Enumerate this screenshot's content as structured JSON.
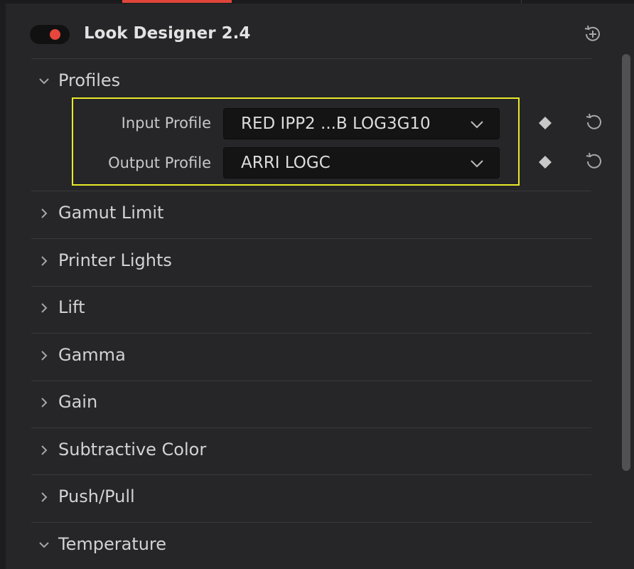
{
  "header": {
    "title": "Look Designer 2.4",
    "toggle_on": true
  },
  "profiles": {
    "label": "Profiles",
    "expanded": true,
    "input_label": "Input Profile",
    "input_value": "RED IPP2 ...B LOG3G10",
    "output_label": "Output Profile",
    "output_value": "ARRI LOGC"
  },
  "sections": [
    {
      "label": "Gamut Limit",
      "expanded": false
    },
    {
      "label": "Printer Lights",
      "expanded": false
    },
    {
      "label": "Lift",
      "expanded": false
    },
    {
      "label": "Gamma",
      "expanded": false
    },
    {
      "label": "Gain",
      "expanded": false
    },
    {
      "label": "Subtractive Color",
      "expanded": false
    },
    {
      "label": "Push/Pull",
      "expanded": false
    },
    {
      "label": "Temperature",
      "expanded": true
    }
  ],
  "colors": {
    "accent": "#e8463c",
    "highlight": "#e9e92a",
    "panel": "#262628"
  },
  "icons": {
    "toggle": "power-toggle",
    "reset_all": "reset-all-icon",
    "keyframe": "diamond-keyframe-icon",
    "reset": "undo-circular-icon",
    "caret": "chevron-down-icon"
  }
}
